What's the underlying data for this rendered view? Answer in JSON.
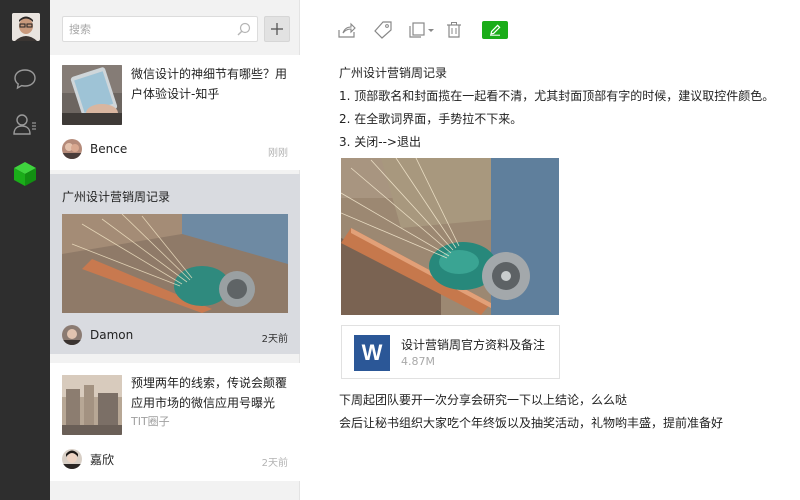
{
  "sidebar": {
    "icons": [
      "user-avatar",
      "chat-bubble-icon",
      "contacts-icon",
      "notes-cube-icon"
    ],
    "active_color": "#1aad19"
  },
  "list": {
    "search_placeholder": "搜索",
    "add_icon": "plus-icon",
    "notes": [
      {
        "title": "微信设计的神细节有哪些？用户体验设计-知乎",
        "author": "Bence",
        "time": "刚刚"
      },
      {
        "title": "广州设计营销周记录",
        "author": "Damon",
        "time": "2天前"
      },
      {
        "title": "预埋两年的线索，传说会颠覆应用市场的微信应用号曝光",
        "source": "TIT圈子",
        "author": "嘉欣",
        "time": "2天前"
      }
    ]
  },
  "toolbar": {
    "icons": [
      "share-icon",
      "tag-icon",
      "copy-icon",
      "delete-icon",
      "edit-icon"
    ],
    "edit_color": "#1aad19"
  },
  "note": {
    "heading": "广州设计营销周记录",
    "items": [
      "1. 顶部歌名和封面揽在一起看不清，尤其封面顶部有字的时候，建议取控件颜色。",
      "2. 在全歌词界面，手势拉不下来。",
      "3. 关闭-->退出"
    ],
    "attachment": {
      "icon_letter": "W",
      "name": "设计营销周官方资料及备注",
      "size": "4.87M"
    },
    "footer": [
      "下周起团队要开一次分享会研究一下以上结论，么么哒",
      "会后让秘书组织大家吃个年终饭以及抽奖活动，礼物哟丰盛，提前准备好"
    ]
  }
}
